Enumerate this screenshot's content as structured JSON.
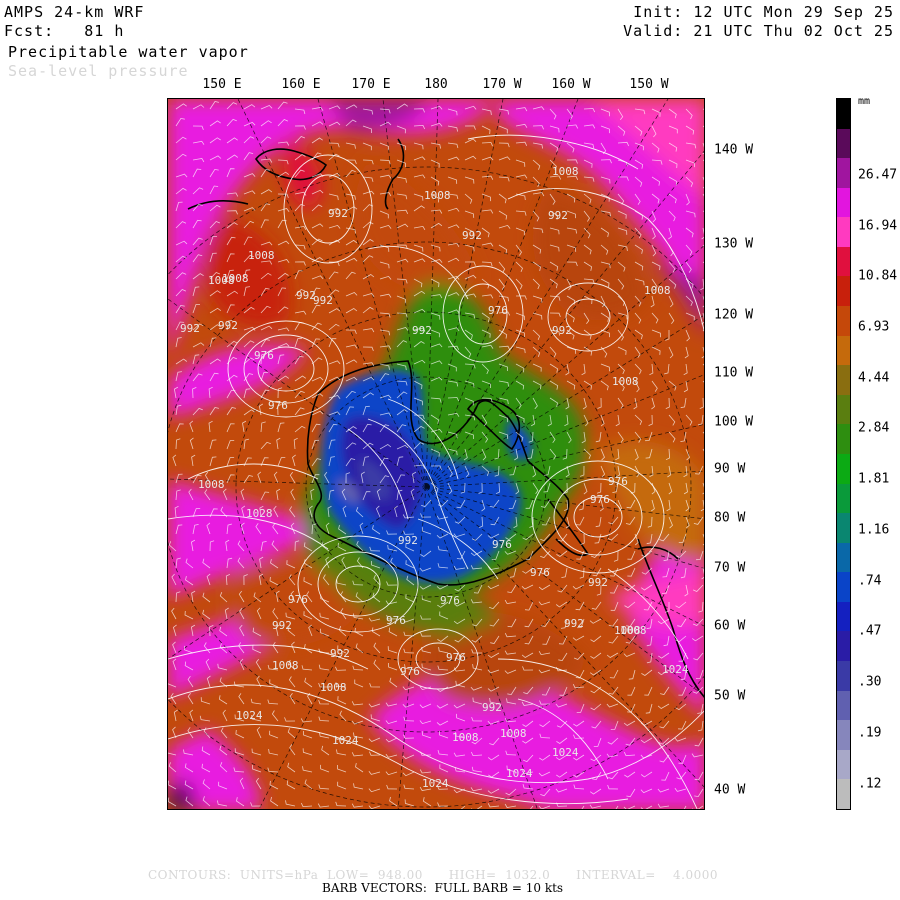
{
  "header": {
    "model": "AMPS 24-km WRF",
    "forecast": "Fcst:   81 h",
    "field": "Precipitable water vapor",
    "overlay": "Sea-level pressure",
    "init": "Init: 12 UTC Mon 29 Sep 25",
    "valid": "Valid: 21 UTC Thu 02 Oct 25"
  },
  "axes": {
    "top_longitudes": [
      "150 E",
      "160 E",
      "170 E",
      "180",
      "170 W",
      "160 W",
      "150 W"
    ],
    "right_longitudes": [
      "140 W",
      "130 W",
      "120 W",
      "110 W",
      "100 W",
      "90 W",
      "80 W",
      "70 W",
      "60 W",
      "50 W",
      "40 W"
    ]
  },
  "colorbar": {
    "unit": "mm",
    "labels": [
      "26.47",
      "16.94",
      "10.84",
      "6.93",
      "4.44",
      "2.84",
      "1.81",
      "1.16",
      ".74",
      ".47",
      ".30",
      ".19",
      ".12"
    ],
    "colors": [
      "#000000",
      "#5a0a5a",
      "#a0159f",
      "#e215df",
      "#ff3ac0",
      "#e0103e",
      "#c8200c",
      "#c5480a",
      "#c56a0c",
      "#8a6e10",
      "#5a7e10",
      "#2e8e10",
      "#0caa14",
      "#0a9a3a",
      "#0a8670",
      "#0a68a8",
      "#0a44c8",
      "#1420c0",
      "#2a1ca6",
      "#3a3aa6",
      "#6060b0",
      "#8686bc",
      "#a8a8c8",
      "#bcbcbc"
    ]
  },
  "map": {
    "pressure_labels": [
      "1008",
      "1008",
      "992",
      "992",
      "992",
      "1008",
      "1008",
      "992",
      "992",
      "976",
      "1008",
      "992",
      "992",
      "992",
      "976",
      "992",
      "976",
      "1008",
      "1008",
      "1008",
      "976",
      "1028",
      "976",
      "992",
      "976",
      "992",
      "976",
      "992",
      "976",
      "976",
      "992",
      "976",
      "976",
      "1008",
      "1008",
      "992",
      "1024",
      "976",
      "1008",
      "1024",
      "1024",
      "1008",
      "1008",
      "1024",
      "1024",
      "1024",
      "1008",
      "992"
    ]
  },
  "footer": {
    "contours": "CONTOURS:  UNITS=hPa  LOW=  948.00      HIGH=  1032.0      INTERVAL=    4.0000",
    "barbs": "BARB VECTORS:  FULL BARB = 10 kts"
  }
}
